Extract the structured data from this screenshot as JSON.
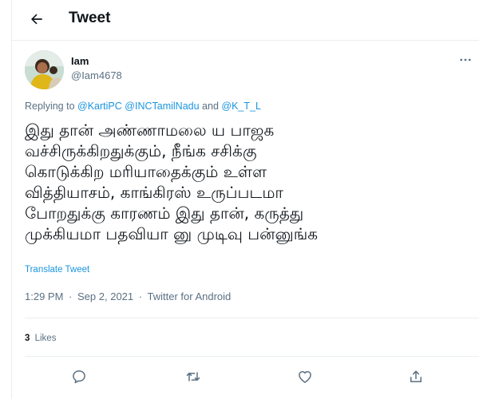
{
  "header": {
    "title": "Tweet",
    "back_icon": "arrow-left-icon"
  },
  "author": {
    "name": "Iam",
    "handle": "@Iam4678"
  },
  "reply": {
    "prefix": "Replying to",
    "mentions": [
      "@KartiPC",
      "@INCTamilNadu",
      "@K_T_L"
    ],
    "conjunction": "and"
  },
  "tweet": {
    "lines": [
      "இது தான் அண்ணாமலை ய பாஜக",
      "வச்சிருக்கிறதுக்கும், நீங்க சசிக்கு",
      "கொடுக்கிற மரியாதைக்கும் உள்ள",
      "வித்தியாசம், காங்கிரஸ் உருப்படமா",
      "போறதுக்கு காரணம் இது தான், கருத்து",
      "முக்கியமா பதவியா னு முடிவு பன்னுங்க"
    ],
    "translate_label": "Translate Tweet"
  },
  "meta": {
    "time": "1:29 PM",
    "date": "Sep 2, 2021",
    "separator": "·",
    "source": "Twitter for Android"
  },
  "stats": {
    "likes_count": "3",
    "likes_label": "Likes"
  },
  "actions": {
    "reply_icon": "reply-icon",
    "retweet_icon": "retweet-icon",
    "like_icon": "like-icon",
    "share_icon": "share-icon"
  },
  "colors": {
    "text_primary": "#0f1419",
    "text_secondary": "#5b7083",
    "link": "#1b95e0",
    "border": "#ebeef0"
  }
}
